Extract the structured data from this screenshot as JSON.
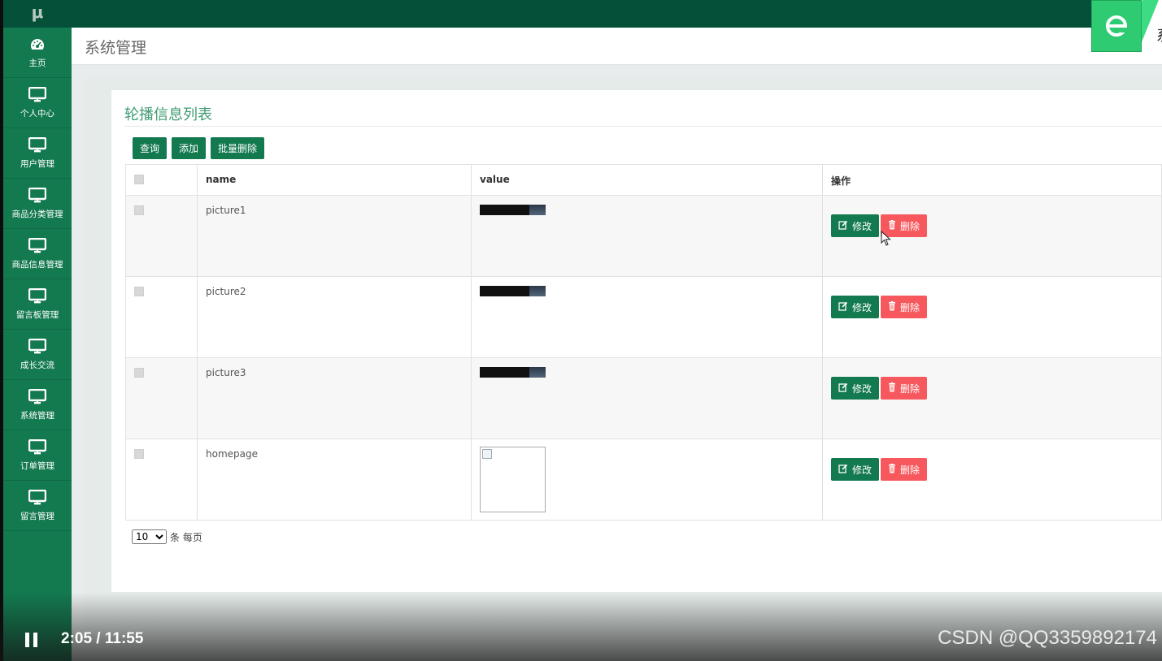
{
  "app": {
    "logo_text": "μ",
    "header_title": "系统管理",
    "badge_letter": "系"
  },
  "sidebar": {
    "items": [
      {
        "label": "主页",
        "icon": "dashboard-icon"
      },
      {
        "label": "个人中心",
        "icon": "monitor-icon"
      },
      {
        "label": "用户管理",
        "icon": "monitor-icon"
      },
      {
        "label": "商品分类管理",
        "icon": "monitor-icon"
      },
      {
        "label": "商品信息管理",
        "icon": "monitor-icon"
      },
      {
        "label": "留言板管理",
        "icon": "monitor-icon"
      },
      {
        "label": "成长交流",
        "icon": "monitor-icon"
      },
      {
        "label": "系统管理",
        "icon": "monitor-icon"
      },
      {
        "label": "订单管理",
        "icon": "monitor-icon"
      },
      {
        "label": "留言管理",
        "icon": "monitor-icon"
      }
    ]
  },
  "panel": {
    "title": "轮播信息列表",
    "buttons": {
      "query": "查询",
      "add": "添加",
      "batch_delete": "批量删除"
    }
  },
  "table": {
    "headers": {
      "name": "name",
      "value": "value",
      "ops": "操作"
    },
    "rows": [
      {
        "name": "picture1",
        "value_type": "image"
      },
      {
        "name": "picture2",
        "value_type": "image"
      },
      {
        "name": "picture3",
        "value_type": "image"
      },
      {
        "name": "homepage",
        "value_type": "broken-image"
      }
    ],
    "edit_label": "修改",
    "delete_label": "删除"
  },
  "pager": {
    "page_size": "10",
    "options": [
      "10"
    ],
    "suffix": "条 每页"
  },
  "video": {
    "time": "2:05 / 11:55",
    "watermark": "CSDN @QQ3359892174"
  },
  "colors": {
    "primary_green": "#13794f",
    "dark_green": "#045039",
    "danger_red": "#f6585d",
    "title_green": "#3f9b72"
  }
}
